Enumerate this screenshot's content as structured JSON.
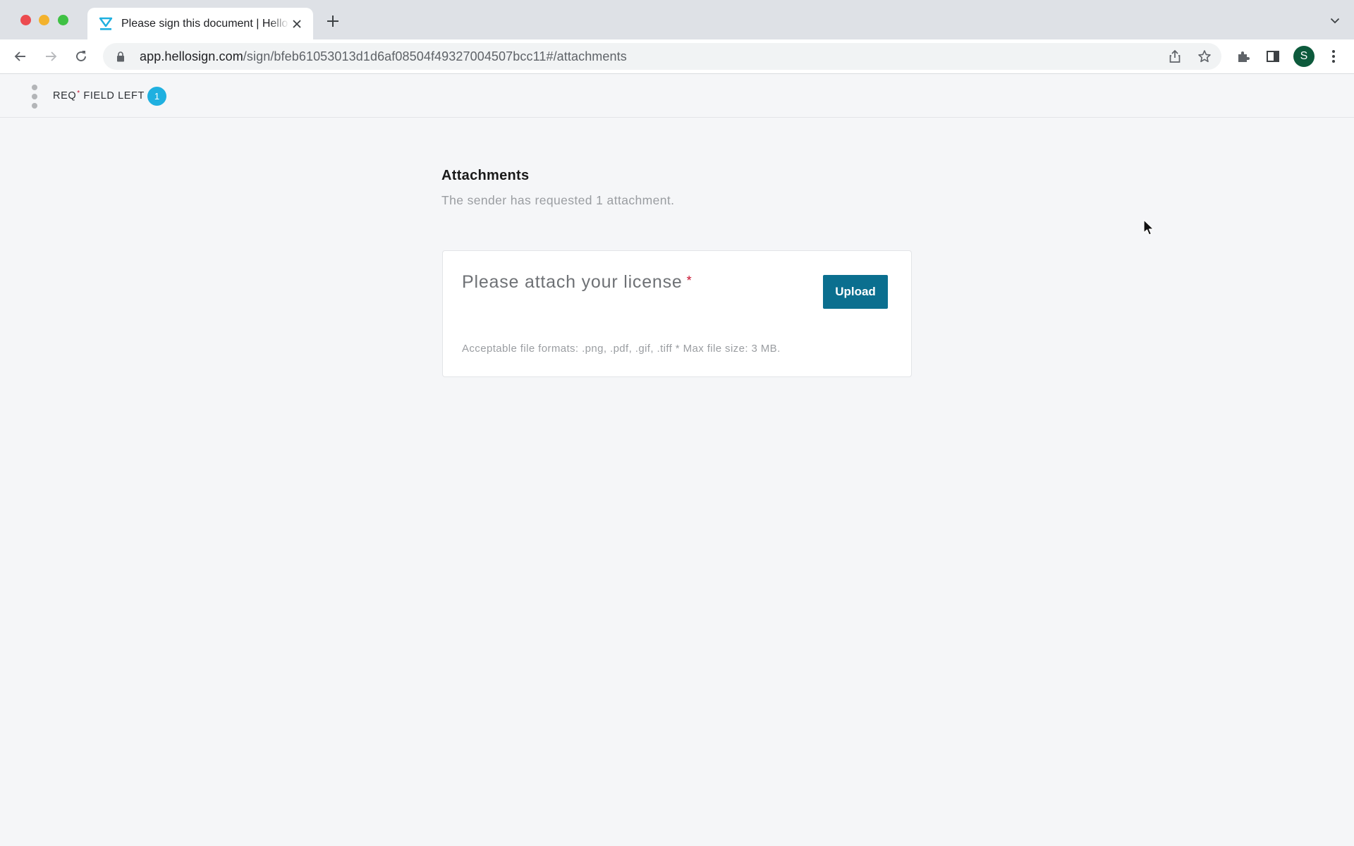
{
  "browser": {
    "tab": {
      "title": "Please sign this document | HelloSign",
      "favicon": "hellosign-logo-icon"
    },
    "url": {
      "host": "app.hellosign.com",
      "path": "/sign/bfeb61053013d1d6af08504f49327004507bcc11#/attachments"
    },
    "profile_initial": "S",
    "colors": {
      "tabbar": "#dee1e6",
      "avatar": "#0d5a3c"
    }
  },
  "header": {
    "req_prefix": "REQ",
    "req_star": "*",
    "req_suffix": " FIELD LEFT",
    "fields_left_count": "1",
    "badge_color": "#1fb0e0"
  },
  "attachments": {
    "title": "Attachments",
    "subtitle": "The sender has requested 1 attachment.",
    "requests": [
      {
        "label": "Please attach your license",
        "required_marker": "*",
        "button_label": "Upload",
        "note": "Acceptable file formats: .png, .pdf, .gif, .tiff * Max file size: 3 MB."
      }
    ],
    "button_color": "#0b6f8f",
    "required_color": "#c8102e"
  }
}
